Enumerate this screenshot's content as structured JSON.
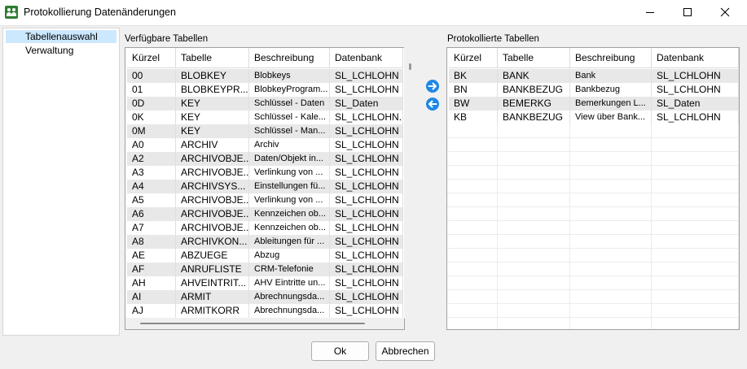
{
  "window": {
    "title": "Protokollierung Datenänderungen"
  },
  "nav": {
    "items": [
      {
        "label": "Tabellenauswahl",
        "selected": true
      },
      {
        "label": "Verwaltung",
        "selected": false
      }
    ]
  },
  "available": {
    "label": "Verfügbare Tabellen",
    "columns": [
      "Kürzel",
      "Tabelle",
      "Beschreibung",
      "Datenbank"
    ],
    "rows": [
      [
        "00",
        "BLOBKEY",
        "Blobkeys",
        "SL_LCHLOHN"
      ],
      [
        "01",
        "BLOBKEYPR...",
        "BlobkeyProgram...",
        "SL_LCHLOHN"
      ],
      [
        "0D",
        "KEY",
        "Schlüssel - Daten",
        "SL_Daten"
      ],
      [
        "0K",
        "KEY",
        "Schlüssel - Kale...",
        "SL_LCHLOHN..."
      ],
      [
        "0M",
        "KEY",
        "Schlüssel - Man...",
        "SL_LCHLOHN"
      ],
      [
        "A0",
        "ARCHIV",
        "Archiv",
        "SL_LCHLOHN"
      ],
      [
        "A2",
        "ARCHIVOBJE...",
        "Daten/Objekt in...",
        "SL_LCHLOHN"
      ],
      [
        "A3",
        "ARCHIVOBJE...",
        "Verlinkung von ...",
        "SL_LCHLOHN"
      ],
      [
        "A4",
        "ARCHIVSYS...",
        "Einstellungen fü...",
        "SL_LCHLOHN"
      ],
      [
        "A5",
        "ARCHIVOBJE...",
        "Verlinkung von ...",
        "SL_LCHLOHN"
      ],
      [
        "A6",
        "ARCHIVOBJE...",
        "Kennzeichen ob...",
        "SL_LCHLOHN"
      ],
      [
        "A7",
        "ARCHIVOBJE...",
        "Kennzeichen ob...",
        "SL_LCHLOHN"
      ],
      [
        "A8",
        "ARCHIVKON...",
        "Ableitungen für ...",
        "SL_LCHLOHN"
      ],
      [
        "AE",
        "ABZUEGE",
        "Abzug",
        "SL_LCHLOHN"
      ],
      [
        "AF",
        "ANRUFLISTE",
        "CRM-Telefonie",
        "SL_LCHLOHN"
      ],
      [
        "AH",
        "AHVEINTRIT...",
        "AHV Eintritte un...",
        "SL_LCHLOHN"
      ],
      [
        "AI",
        "ARMIT",
        "Abrechnungsda...",
        "SL_LCHLOHN"
      ],
      [
        "AJ",
        "ARMITKORR",
        "Abrechnungsda...",
        "SL_LCHLOHN"
      ]
    ]
  },
  "logged": {
    "label": "Protokollierte Tabellen",
    "columns": [
      "Kürzel",
      "Tabelle",
      "Beschreibung",
      "Datenbank"
    ],
    "rows": [
      [
        "BK",
        "BANK",
        "Bank",
        "SL_LCHLOHN"
      ],
      [
        "BN",
        "BANKBEZUG",
        "Bankbezug",
        "SL_LCHLOHN"
      ],
      [
        "BW",
        "BEMERKG",
        "Bemerkungen L...",
        "SL_Daten"
      ],
      [
        "KB",
        "BANKBEZUG",
        "View über Bank...",
        "SL_LCHLOHN"
      ]
    ]
  },
  "actions": {
    "ok": "Ok",
    "cancel": "Abbrechen"
  },
  "icons": {
    "move_right": "arrow-right-circle-icon",
    "move_left": "arrow-left-circle-icon",
    "accent": "#1e88e5",
    "app_icon": "#2e7d32"
  }
}
